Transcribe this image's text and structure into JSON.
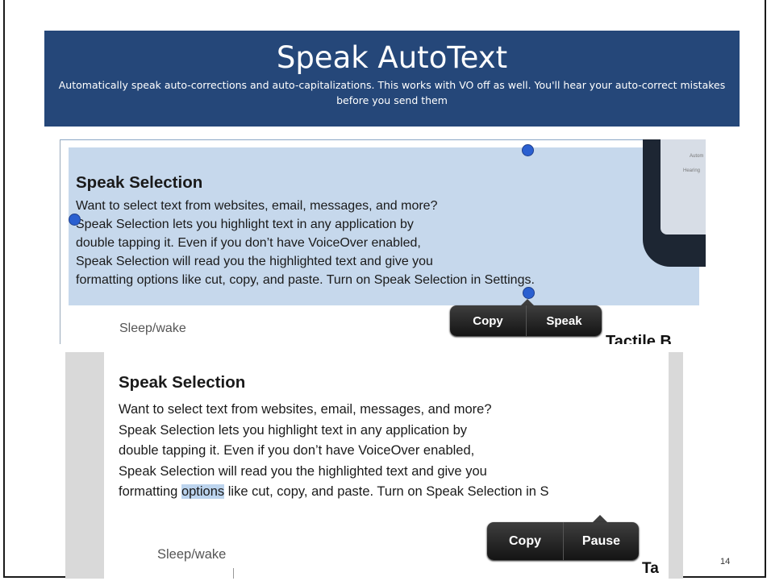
{
  "slide": {
    "title": "Speak AutoText",
    "subtitle": "Automatically speak auto-corrections and auto-capitalizations. This works with VO off as well. You'll hear your auto-correct mistakes before you send them",
    "page_number": "14"
  },
  "screenshot_top": {
    "heading": "Speak Selection",
    "lines": [
      "Want to select text from websites, email, messages, and more?",
      "Speak Selection lets you highlight text in any application by",
      "double tapping it. Even if you don’t have VoiceOver enabled,",
      "Speak Selection will read you the highlighted text and give you",
      "formatting options like cut, copy, and paste. Turn on Speak Selection in Settings."
    ],
    "popup": {
      "copy_label": "Copy",
      "speak_label": "Speak"
    },
    "sleep_label": "Sleep/wake",
    "cut_off_label": "Tactile B",
    "phone_labels": [
      "Autom",
      "Hearing"
    ]
  },
  "screenshot_bottom": {
    "heading": "Speak Selection",
    "lines": [
      "Want to select text from websites, email, messages, and more?",
      "Speak Selection lets you highlight text in any application by",
      "double tapping it. Even if you don’t have VoiceOver enabled,",
      "Speak Selection will read you the highlighted text and give you"
    ],
    "last_line_before": "formatting ",
    "selected_word": "options",
    "last_line_after": " like cut, copy, and paste. Turn on Speak Selection in S",
    "popup": {
      "copy_label": "Copy",
      "pause_label": "Pause"
    },
    "sleep_label": "Sleep/wake",
    "cut_off_label": "Ta"
  },
  "colors": {
    "banner": "#254779",
    "highlight": "#c6d8ec",
    "selection_handle": "#2a5fd0"
  }
}
